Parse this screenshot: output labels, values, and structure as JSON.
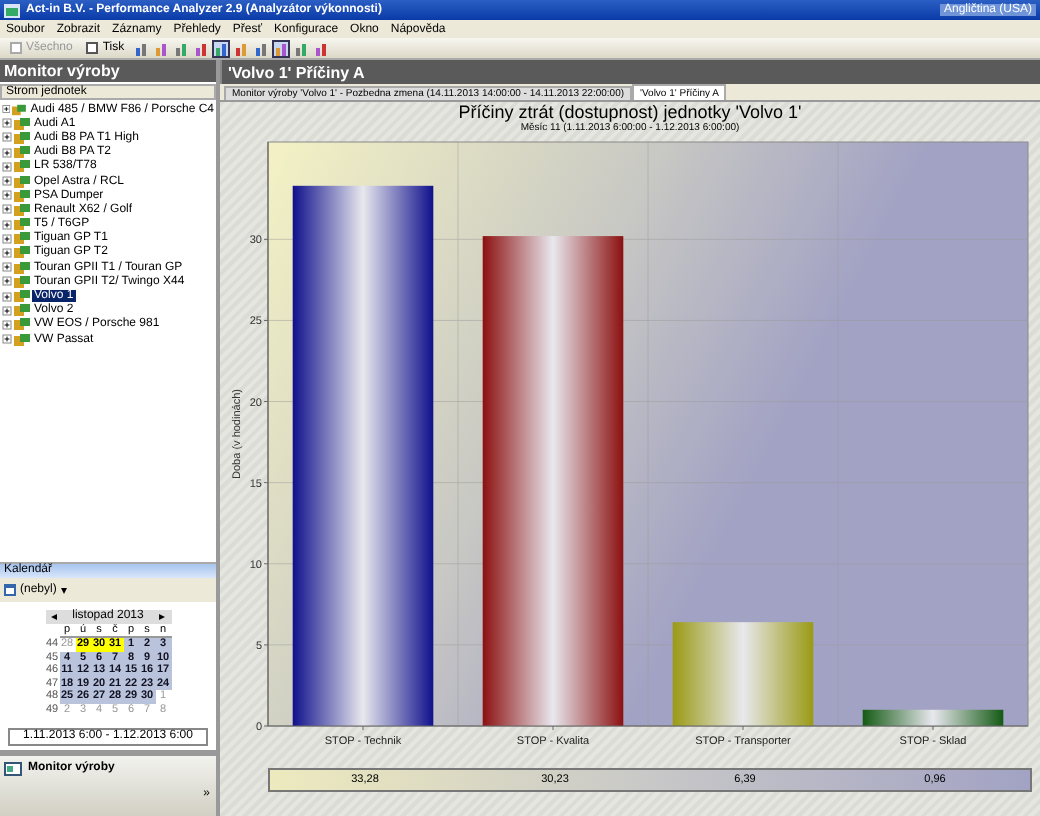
{
  "window": {
    "title": "Act-in B.V. - Performance Analyzer 2.9 (Analyzátor výkonnosti)",
    "language": "Angličtina (USA)"
  },
  "menu": [
    "Soubor",
    "Zobrazit",
    "Záznamy",
    "Přehledy",
    "Přesť",
    "Konfigurace",
    "Okno",
    "Nápověda"
  ],
  "toolbar": [
    {
      "kind": "text",
      "label": "Všechno",
      "disabled": true
    },
    {
      "kind": "text",
      "label": "Tisk",
      "disabled": false
    },
    {
      "kind": "icon",
      "pressed": false
    },
    {
      "kind": "icon",
      "pressed": false
    },
    {
      "kind": "icon",
      "pressed": false
    },
    {
      "kind": "icon",
      "pressed": false
    },
    {
      "kind": "icon",
      "pressed": true
    },
    {
      "kind": "icon",
      "pressed": false
    },
    {
      "kind": "icon",
      "pressed": false
    },
    {
      "kind": "icon",
      "pressed": true
    },
    {
      "kind": "icon",
      "pressed": false
    },
    {
      "kind": "icon",
      "pressed": false
    }
  ],
  "sidebar": {
    "title": "Monitor výroby",
    "tree_header": "Strom jednotek",
    "items": [
      {
        "label": "Audi 485 / BMW F86 / Porsche C4",
        "selected": false
      },
      {
        "label": "Audi A1",
        "selected": false
      },
      {
        "label": "Audi B8 PA T1 High",
        "selected": false
      },
      {
        "label": "Audi B8 PA T2",
        "selected": false
      },
      {
        "label": "LR 538/T78",
        "selected": false
      },
      {
        "label": "Opel Astra / RCL",
        "selected": false
      },
      {
        "label": "PSA Dumper",
        "selected": false
      },
      {
        "label": "Renault X62 / Golf",
        "selected": false
      },
      {
        "label": "T5 / T6GP",
        "selected": false
      },
      {
        "label": "Tiguan GP T1",
        "selected": false
      },
      {
        "label": "Tiguan GP T2",
        "selected": false
      },
      {
        "label": "Touran GPII T1 / Touran GP",
        "selected": false
      },
      {
        "label": "Touran GPII T2/ Twingo X44",
        "selected": false
      },
      {
        "label": "Volvo 1",
        "selected": true
      },
      {
        "label": "Volvo 2",
        "selected": false
      },
      {
        "label": "VW EOS / Porsche 981",
        "selected": false
      },
      {
        "label": "VW Passat",
        "selected": false
      }
    ]
  },
  "calendar": {
    "title": "Kalendář",
    "dropdown": "(nebyl)",
    "dropdown_caret": "▾",
    "month": "listopad 2013",
    "prev": "◂",
    "next": "▸",
    "weekdays": [
      "p",
      "ú",
      "s",
      "č",
      "p",
      "s",
      "n"
    ],
    "weeks": [
      {
        "number": "44",
        "days": [
          {
            "day": "28",
            "selected": false,
            "highlighted": false,
            "dimmed": true
          },
          {
            "day": "29",
            "selected": false,
            "highlighted": true,
            "dimmed": false
          },
          {
            "day": "30",
            "selected": false,
            "highlighted": true,
            "dimmed": false
          },
          {
            "day": "31",
            "selected": false,
            "highlighted": true,
            "dimmed": false
          },
          {
            "day": "1",
            "selected": true,
            "highlighted": false,
            "dimmed": false
          },
          {
            "day": "2",
            "selected": true,
            "highlighted": false,
            "dimmed": false
          },
          {
            "day": "3",
            "selected": true,
            "highlighted": false,
            "dimmed": false
          }
        ]
      },
      {
        "number": "45",
        "days": [
          {
            "day": "4",
            "selected": true,
            "highlighted": false,
            "dimmed": false
          },
          {
            "day": "5",
            "selected": true,
            "highlighted": false,
            "dimmed": false
          },
          {
            "day": "6",
            "selected": true,
            "highlighted": false,
            "dimmed": false
          },
          {
            "day": "7",
            "selected": true,
            "highlighted": false,
            "dimmed": false
          },
          {
            "day": "8",
            "selected": true,
            "highlighted": false,
            "dimmed": false
          },
          {
            "day": "9",
            "selected": true,
            "highlighted": false,
            "dimmed": false
          },
          {
            "day": "10",
            "selected": true,
            "highlighted": false,
            "dimmed": false
          }
        ]
      },
      {
        "number": "46",
        "days": [
          {
            "day": "11",
            "selected": true,
            "highlighted": false,
            "dimmed": false
          },
          {
            "day": "12",
            "selected": true,
            "highlighted": false,
            "dimmed": false
          },
          {
            "day": "13",
            "selected": true,
            "highlighted": false,
            "dimmed": false
          },
          {
            "day": "14",
            "selected": true,
            "highlighted": false,
            "dimmed": false
          },
          {
            "day": "15",
            "selected": true,
            "highlighted": false,
            "dimmed": false
          },
          {
            "day": "16",
            "selected": true,
            "highlighted": false,
            "dimmed": false
          },
          {
            "day": "17",
            "selected": true,
            "highlighted": false,
            "dimmed": false
          }
        ]
      },
      {
        "number": "47",
        "days": [
          {
            "day": "18",
            "selected": true,
            "highlighted": false,
            "dimmed": false
          },
          {
            "day": "19",
            "selected": true,
            "highlighted": false,
            "dimmed": false
          },
          {
            "day": "20",
            "selected": true,
            "highlighted": false,
            "dimmed": false
          },
          {
            "day": "21",
            "selected": true,
            "highlighted": false,
            "dimmed": false
          },
          {
            "day": "22",
            "selected": true,
            "highlighted": false,
            "dimmed": false
          },
          {
            "day": "23",
            "selected": true,
            "highlighted": false,
            "dimmed": false
          },
          {
            "day": "24",
            "selected": true,
            "highlighted": false,
            "dimmed": false
          }
        ]
      },
      {
        "number": "48",
        "days": [
          {
            "day": "25",
            "selected": true,
            "highlighted": false,
            "dimmed": false
          },
          {
            "day": "26",
            "selected": true,
            "highlighted": false,
            "dimmed": false
          },
          {
            "day": "27",
            "selected": true,
            "highlighted": false,
            "dimmed": false
          },
          {
            "day": "28",
            "selected": true,
            "highlighted": false,
            "dimmed": false
          },
          {
            "day": "29",
            "selected": true,
            "highlighted": false,
            "dimmed": false
          },
          {
            "day": "30",
            "selected": true,
            "highlighted": false,
            "dimmed": false
          },
          {
            "day": "1",
            "selected": false,
            "highlighted": false,
            "dimmed": true
          }
        ]
      },
      {
        "number": "49",
        "days": [
          {
            "day": "2",
            "selected": false,
            "highlighted": false,
            "dimmed": true
          },
          {
            "day": "3",
            "selected": false,
            "highlighted": false,
            "dimmed": true
          },
          {
            "day": "4",
            "selected": false,
            "highlighted": false,
            "dimmed": true
          },
          {
            "day": "5",
            "selected": false,
            "highlighted": false,
            "dimmed": true
          },
          {
            "day": "6",
            "selected": false,
            "highlighted": false,
            "dimmed": true
          },
          {
            "day": "7",
            "selected": false,
            "highlighted": false,
            "dimmed": true
          },
          {
            "day": "8",
            "selected": false,
            "highlighted": false,
            "dimmed": true
          }
        ]
      }
    ],
    "range": "1.11.2013 6:00 - 1.12.2013 6:00"
  },
  "nav": {
    "label": "Monitor výroby",
    "chevron": "»"
  },
  "document": {
    "title": "'Volvo 1' Příčiny A",
    "tabs": [
      {
        "label": "Monitor výroby 'Volvo 1' - Pozbedna zmena (14.11.2013 14:00:00 - 14.11.2013 22:00:00)",
        "selected": false
      },
      {
        "label": "'Volvo 1' Příčiny A",
        "selected": true
      }
    ],
    "chart": {
      "title": "Příčiny ztrát (dostupnost) jednotky  'Volvo 1'",
      "subtitle": "Měsíc 11 (1.11.2013 6:00:00 - 1.12.2013 6:00:00)",
      "chart_data": {
        "type": "bar",
        "ylabel": "Doba (v hodinách)",
        "categories": [
          "STOP - Technik",
          "STOP - Kvalita",
          "STOP - Transporter",
          "STOP - Sklad"
        ],
        "series": [
          {
            "values": [
              33.3,
              30.2,
              6.4,
              1.0
            ]
          }
        ],
        "grid": true,
        "ylim": [
          0,
          36
        ],
        "yticks": [
          0,
          5,
          10,
          15,
          20,
          25,
          30
        ]
      },
      "value_row": [
        "33,28",
        "30,23",
        "6,39",
        "0,96"
      ]
    }
  }
}
